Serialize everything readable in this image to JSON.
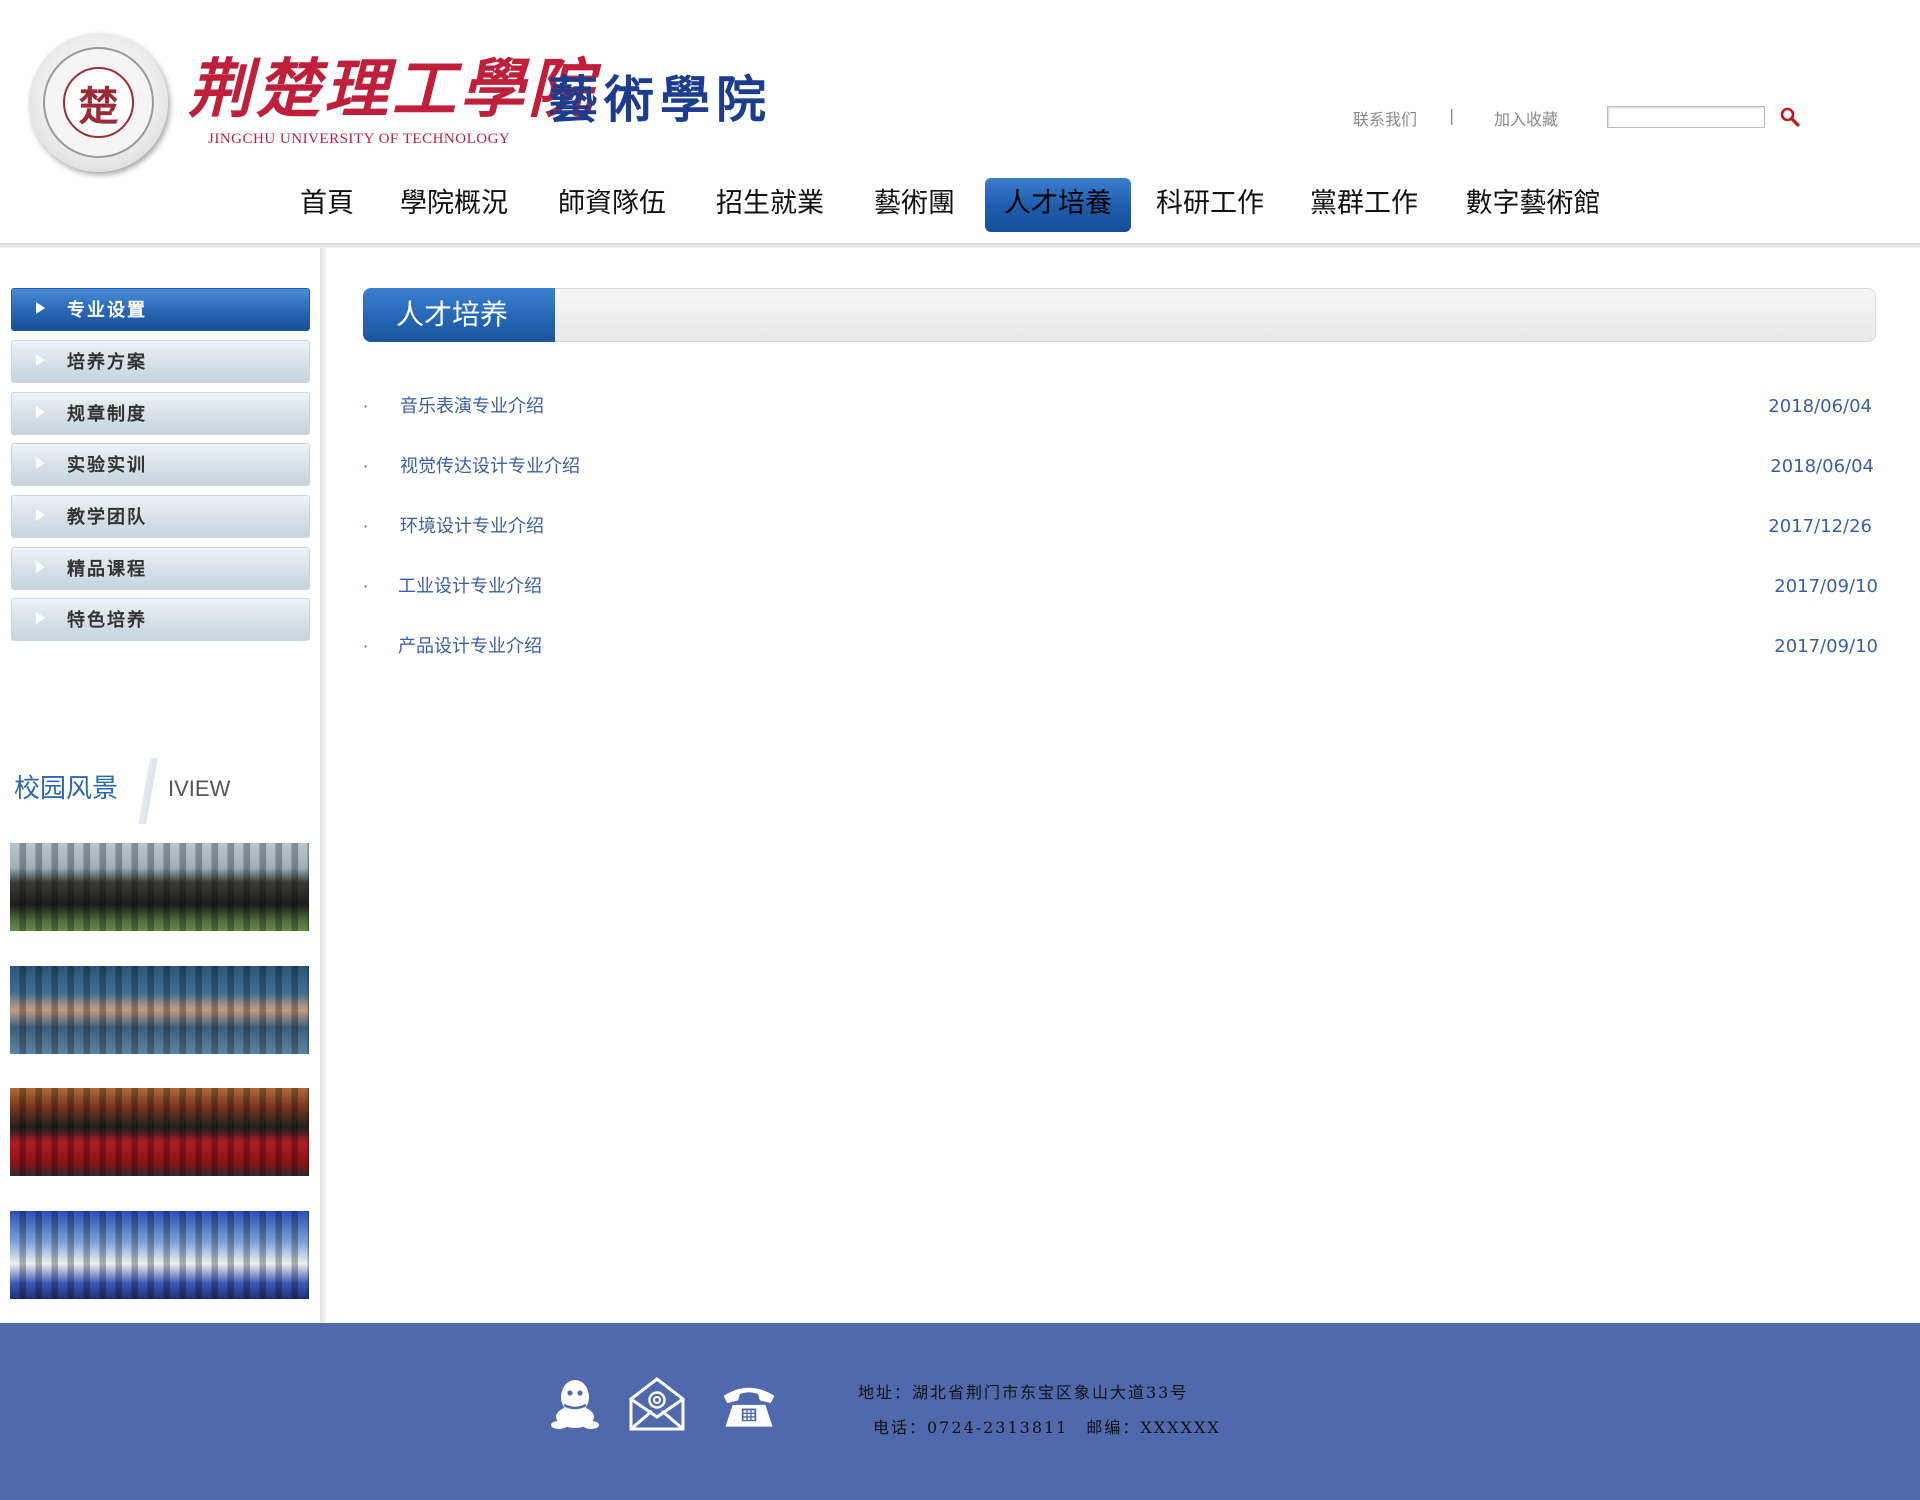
{
  "header": {
    "seal_char": "楚",
    "school_name": "荆楚理工學院",
    "school_en": "JINGCHU UNIVERSITY OF TECHNOLOGY",
    "college_name": "藝術學院",
    "contact_label": "联系我们",
    "separator": "|",
    "bookmark_label": "加入收藏",
    "search_placeholder": ""
  },
  "nav": [
    {
      "label": "首頁",
      "active": false
    },
    {
      "label": "學院概況",
      "active": false
    },
    {
      "label": "師資隊伍",
      "active": false
    },
    {
      "label": "招生就業",
      "active": false
    },
    {
      "label": "藝術團",
      "active": false
    },
    {
      "label": "人才培養",
      "active": true
    },
    {
      "label": "科研工作",
      "active": false
    },
    {
      "label": "黨群工作",
      "active": false
    },
    {
      "label": "數字藝術館",
      "active": false
    }
  ],
  "sidebar": {
    "menu": [
      {
        "label": "专业设置",
        "active": true
      },
      {
        "label": "培养方案",
        "active": false
      },
      {
        "label": "规章制度",
        "active": false
      },
      {
        "label": "实验实训",
        "active": false
      },
      {
        "label": "教学团队",
        "active": false
      },
      {
        "label": "精品课程",
        "active": false
      },
      {
        "label": "特色培养",
        "active": false
      }
    ],
    "scenery_title": "校园风景",
    "scenery_sub": "IVIEW"
  },
  "content": {
    "section_title": "人才培养",
    "bullet": "·",
    "news": [
      {
        "title": "音乐表演专业介绍",
        "date": "2018/06/04"
      },
      {
        "title": "视觉传达设计专业介绍",
        "date": "2018/06/04"
      },
      {
        "title": "环境设计专业介绍",
        "date": "2017/12/26"
      },
      {
        "title": "工业设计专业介绍",
        "date": "2017/09/10"
      },
      {
        "title": "产品设计专业介绍",
        "date": "2017/09/10"
      }
    ]
  },
  "footer": {
    "address": "地址：湖北省荆门市东宝区象山大道33号",
    "contact": "电话：0724-2313811　邮编：XXXXXX"
  },
  "colors": {
    "accent_blue": "#2467b6",
    "footer_bg": "#5069ad",
    "brand_red": "#c01f3b",
    "link_blue": "#3c5fa3"
  },
  "icons": [
    "search-icon",
    "qq-icon",
    "email-icon",
    "telephone-icon",
    "menu-arrow-icon"
  ]
}
